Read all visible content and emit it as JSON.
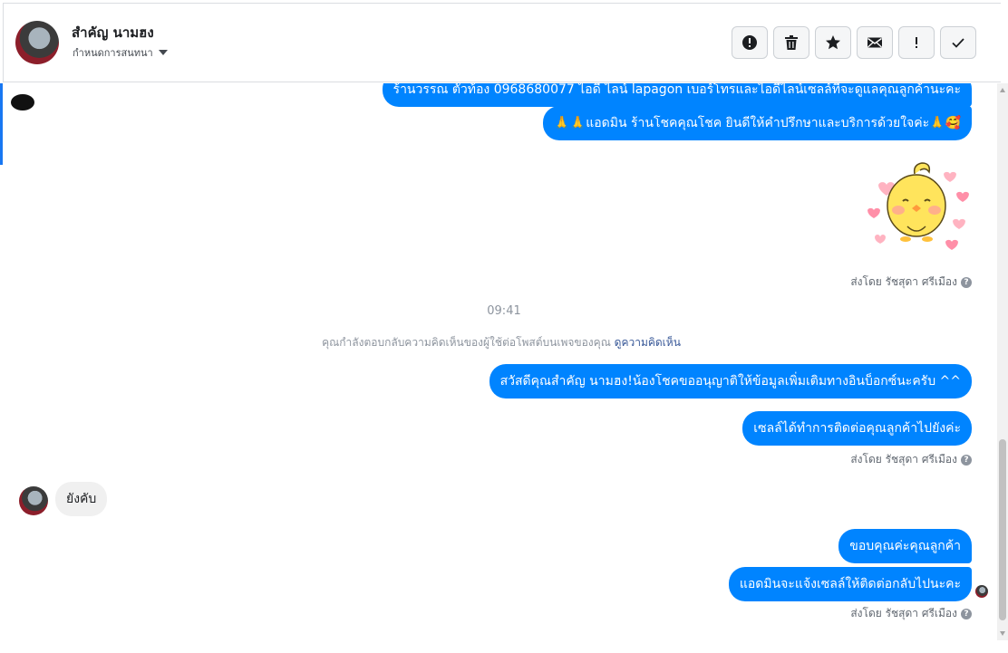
{
  "header": {
    "contact_name": "สำคัญ นามฮง",
    "assign_label": "กำหนดการสนทนา",
    "toolbar": [
      {
        "name": "report-spam-button",
        "icon": "alert-circle-icon"
      },
      {
        "name": "delete-button",
        "icon": "trash-icon"
      },
      {
        "name": "star-button",
        "icon": "star-icon"
      },
      {
        "name": "mark-unread-button",
        "icon": "envelope-icon"
      },
      {
        "name": "follow-up-button",
        "icon": "exclamation-icon"
      },
      {
        "name": "mark-done-button",
        "icon": "checkmark-icon"
      }
    ]
  },
  "messages": {
    "m1": "ร้านวรรณ ตัวท้อง 0968680077 ไอดี ไลน์ lapagon เบอร์โทรและไอดีไลน์เซลล์ที่จะดูแลคุณลูกค้านะคะ",
    "m2": "🙏🙏แอดมิน ร้านโชคคุณโชค ยินดีให้คำปรึกษาและบริการด้วยใจค่ะ🙏🥰",
    "sent_by_1": "ส่งโดย รัชสุดา ศรีเมือง",
    "timestamp": "09:41",
    "context_text": "คุณกำลังตอบกลับความคิดเห็นของผู้ใช้ต่อโพสต์บนเพจของคุณ",
    "context_link": "ดูความคิดเห็น",
    "m3": "สวัสดีคุณสำคัญ นามฮง!น้องโชคขออนุญาติให้ข้อมูลเพิ่มเติมทางอินบ็อกซ์นะครับ ^^",
    "m4": "เซลล์ได้ทำการติดต่อคุณลูกค้าไปยังค่ะ",
    "sent_by_2": "ส่งโดย รัชสุดา ศรีเมือง",
    "incoming_1": "ยังคับ",
    "m5": "ขอบคุณค่ะคุณลูกค้า",
    "m6": "แอดมินจะแจ้งเซลล์ให้ติดต่อกลับไปนะคะ",
    "sent_by_3": "ส่งโดย รัชสุดา ศรีเมือง"
  },
  "colors": {
    "outgoing_bubble": "#0084ff",
    "incoming_bubble": "#f0f0f0",
    "accent": "#1877f2"
  }
}
